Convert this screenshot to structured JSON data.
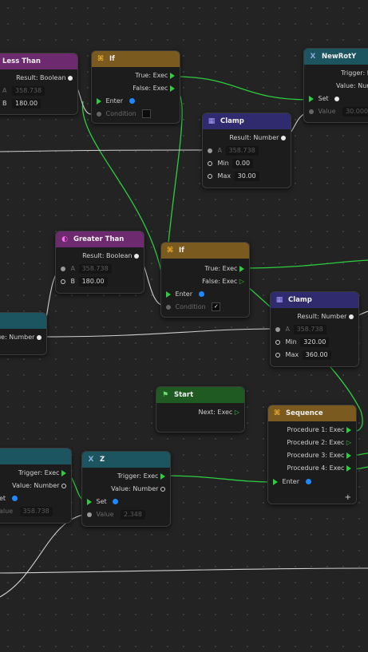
{
  "colors": {
    "background": "#232323",
    "exec_wire": "#2ecc40",
    "data_wire": "#cfcfcf",
    "header_compare": "#6d2a6e",
    "header_flow": "#7a5a1e",
    "header_math": "#302a6e",
    "header_variable": "#1c5460",
    "header_event": "#1e5a22"
  },
  "nodes": {
    "less_than": {
      "title": "Less Than",
      "result": "Result: Boolean",
      "a_label": "A",
      "a_value": "358.738",
      "b_label": "B",
      "b_value": "180.00"
    },
    "if_top": {
      "title": "If",
      "true_exec": "True: Exec",
      "false_exec": "False: Exec",
      "enter": "Enter",
      "condition": "Condition"
    },
    "newroty": {
      "title": "NewRotY",
      "trigger": "Trigger: E",
      "value_out": "Value: Numb",
      "set": "Set",
      "value_in": "Value",
      "value_in_val": "30.000"
    },
    "clamp_top": {
      "title": "Clamp",
      "result": "Result: Number",
      "a_label": "A",
      "a_value": "358.738",
      "min_label": "Min",
      "min_value": "0.00",
      "max_label": "Max",
      "max_value": "30.00"
    },
    "greater_than": {
      "title": "Greater Than",
      "result": "Result: Boolean",
      "a_label": "A",
      "a_value": "358.738",
      "b_label": "B",
      "b_value": "180.00"
    },
    "if_mid": {
      "title": "If",
      "true_exec": "True: Exec",
      "false_exec": "False: Exec",
      "enter": "Enter",
      "condition": "Condition"
    },
    "left_number": {
      "value_out": "ue: Number"
    },
    "clamp_mid": {
      "title": "Clamp",
      "result": "Result: Number",
      "a_label": "A",
      "a_value": "358.738",
      "min_label": "Min",
      "min_value": "320.00",
      "max_label": "Max",
      "max_value": "360.00"
    },
    "start": {
      "title": "Start",
      "next": "Next: Exec"
    },
    "sequence": {
      "title": "Sequence",
      "p1": "Procedure 1: Exec",
      "p2": "Procedure 2: Exec",
      "p3": "Procedure 3: Exec",
      "p4": "Procedure 4: Exec",
      "enter": "Enter",
      "add": "+"
    },
    "left_var": {
      "trigger": "Trigger: Exec",
      "value_out": "Value: Number",
      "set": "et",
      "value_in": "alue",
      "value_in_val": "358.738"
    },
    "z": {
      "title": "Z",
      "trigger": "Trigger: Exec",
      "value_out": "Value: Number",
      "set": "Set",
      "value_in": "Value",
      "value_in_val": "2.348"
    }
  }
}
